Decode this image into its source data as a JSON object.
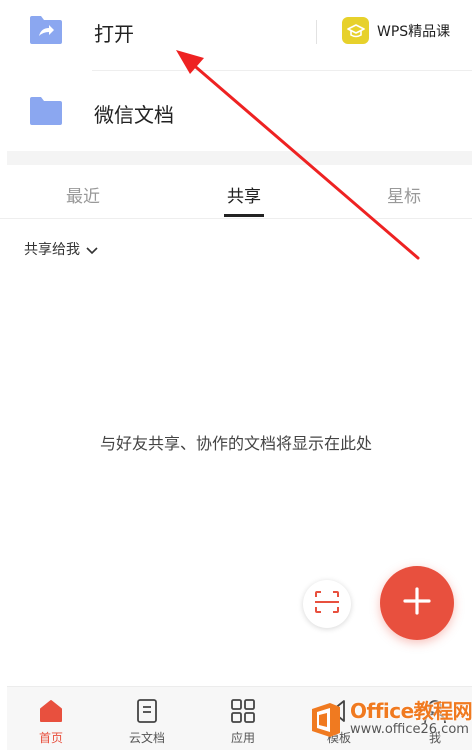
{
  "rows": {
    "open": {
      "label": "打开"
    },
    "wps_course": {
      "label": "WPS精品课"
    },
    "wechat": {
      "label": "微信文档"
    }
  },
  "tabs": [
    {
      "label": "最近",
      "active": false
    },
    {
      "label": "共享",
      "active": true
    },
    {
      "label": "星标",
      "active": false
    }
  ],
  "filter": {
    "label": "共享给我",
    "icon": "chevron-down-icon"
  },
  "empty_state": {
    "message": "与好友共享、协作的文档将显示在此处"
  },
  "fab": {
    "icon": "plus-icon"
  },
  "scan": {
    "icon": "scan-icon"
  },
  "bottom_nav": [
    {
      "label": "首页",
      "icon": "home-icon",
      "active": true
    },
    {
      "label": "云文档",
      "icon": "document-icon",
      "active": false
    },
    {
      "label": "应用",
      "icon": "grid-icon",
      "active": false
    },
    {
      "label": "模板",
      "icon": "template-icon",
      "active": false
    },
    {
      "label": "我",
      "icon": "user-icon",
      "active": false
    }
  ],
  "watermark": {
    "brand": "Office教程网",
    "url": "www.office26.com"
  },
  "colors": {
    "accent": "#e8503e",
    "folder": "#8ba7f0",
    "wps_badge": "#e7d12b",
    "annotation_arrow": "#ee2222",
    "watermark": "#f07a20"
  }
}
